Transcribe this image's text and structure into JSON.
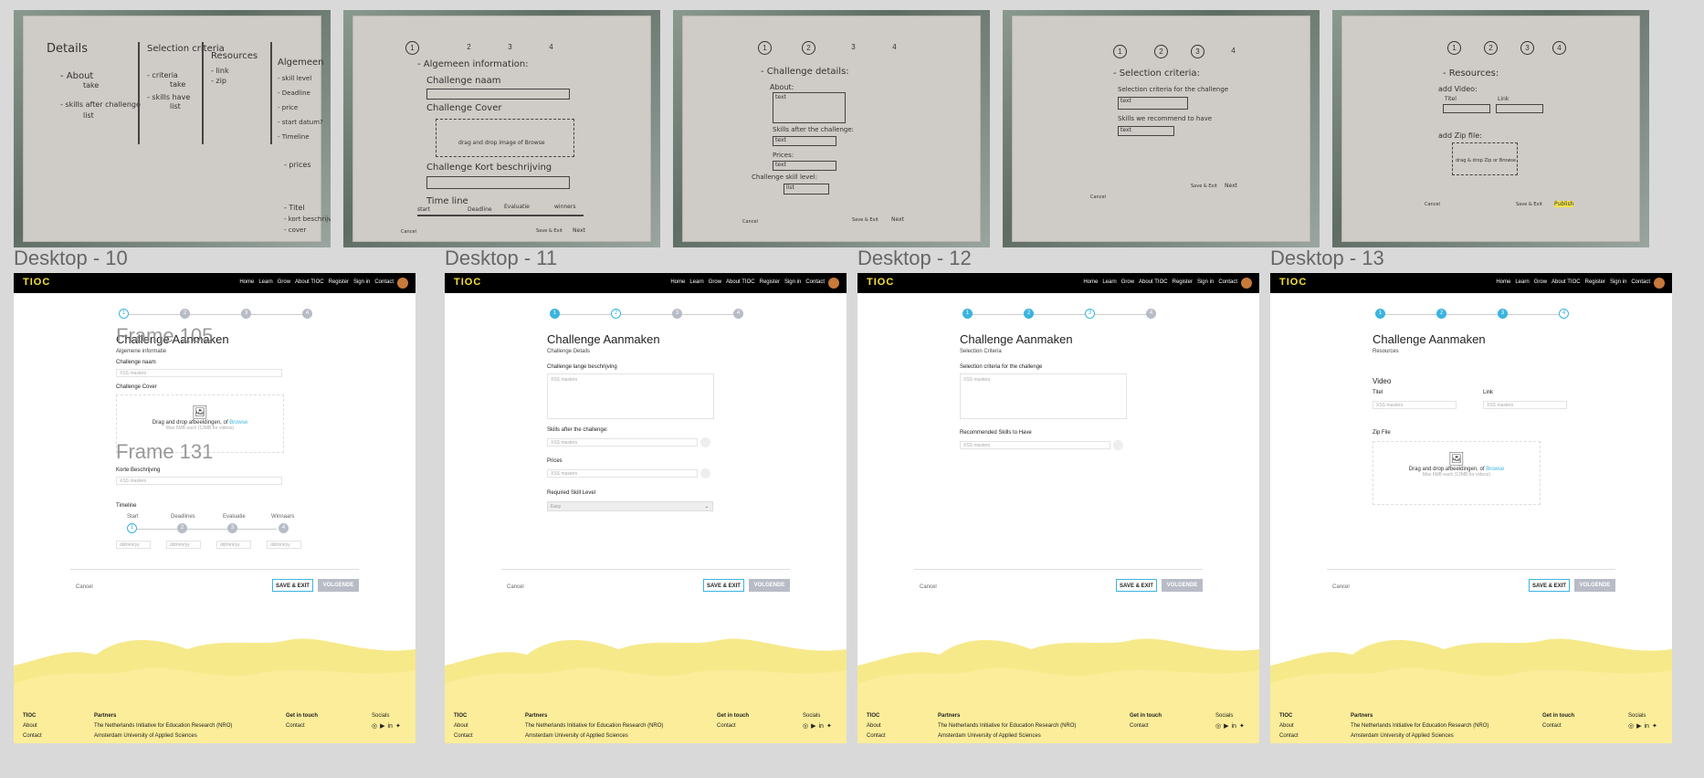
{
  "sketches": {
    "s1": {
      "lines": [
        "Details",
        "- About",
        "take",
        "- skills after challenge",
        "list",
        "Selection criteria",
        "- criteria",
        "take",
        "- skills have",
        "list",
        "Resources",
        "- link",
        "- zip",
        "Algemeen",
        "- skill level",
        "- Deadline",
        "- price",
        "- start datum?",
        "- Timeline",
        "- prices",
        "- Titel",
        "- kort beschrijving",
        "- cover"
      ]
    },
    "s2": {
      "lines": [
        "1",
        "2",
        "3",
        "4",
        "- Algemeen information:",
        "Challenge naam",
        "Challenge Cover",
        "drag and drop image of Browse",
        "Challenge Kort beschrijving",
        "Time line",
        "start",
        "Deadline",
        "Evaluatie",
        "winners",
        "Cancel",
        "Save & Exit",
        "Next"
      ]
    },
    "s3": {
      "lines": [
        "1",
        "2",
        "3",
        "4",
        "- Challenge details:",
        "About:",
        "text",
        "Skills after the challenge:",
        "text",
        "Prices:",
        "text",
        "Challenge skill level:",
        "list",
        "Cancel",
        "Save & Exit",
        "Next"
      ]
    },
    "s4": {
      "lines": [
        "1",
        "2",
        "3",
        "4",
        "- Selection criteria:",
        "Selection criteria for the challenge",
        "text",
        "Skills we recommend to have",
        "text",
        "Cancel",
        "Save & Exit",
        "Next"
      ]
    },
    "s5": {
      "lines": [
        "1",
        "2",
        "3",
        "4",
        "- Resources:",
        "add Video:",
        "Titel",
        "Link",
        "add Zip file:",
        "drag & drop Zip or Browse",
        "Cancel",
        "Save & Exit",
        "Publish"
      ]
    }
  },
  "labels": {
    "d10": "Desktop - 10",
    "d11": "Desktop - 11",
    "d12": "Desktop - 12",
    "d13": "Desktop - 13",
    "frame105": "Frame 105",
    "frame131": "Frame 131"
  },
  "nav": {
    "logo": "TIOC",
    "links": [
      "Home",
      "Learn",
      "Grow",
      "About TIOC",
      "Register",
      "Sign in",
      "Contact"
    ]
  },
  "common": {
    "title": "Challenge Aanmaken",
    "placeholder": "XSS masters",
    "cancel": "Cancel",
    "save": "SAVE & EXIT",
    "next": "VOLGENDE",
    "drop_text": "Drag and drop afbeeldingen, of",
    "browse": "Browse"
  },
  "d10": {
    "subtitle": "Algemene informatie",
    "name_label": "Challenge naam",
    "cover_label": "Challenge Cover",
    "cover_hint": "Max 6MB each (12MB for videos)",
    "short_label": "Korte Beschrijving",
    "timeline_label": "Timeline",
    "steps": [
      "Start",
      "Deadlines",
      "Evaluatie",
      "Winnaars"
    ],
    "date": "dd/mm/yy"
  },
  "d11": {
    "subtitle": "Challenge Details",
    "desc_label": "Challenge lange beschrijving",
    "skills_label": "Skills after the challenge:",
    "prices_label": "Prices",
    "level_label": "Required Skill Level",
    "level_value": "Easy"
  },
  "d12": {
    "subtitle": "Selection Criteria",
    "criteria_label": "Selection criteria for the challenge",
    "rec_label": "Recommended Skills to Have"
  },
  "d13": {
    "subtitle": "Resources",
    "video_label": "Video",
    "titel_label": "Titel",
    "link_label": "Link",
    "zip_label": "Zip File",
    "zip_hint": "Max 6MB each (12MB for videos)"
  },
  "footer": {
    "col1": {
      "head": "TIOC",
      "items": [
        "About",
        "Contact"
      ]
    },
    "col2": {
      "head": "Partners",
      "items": [
        "The Netherlands Initiative for Education Research (NRO)",
        "Amsterdam University of Applied Sciences"
      ]
    },
    "col3": {
      "head": "Get in touch",
      "items": [
        "Contact"
      ]
    },
    "col4": {
      "head": "Socials"
    }
  },
  "colors": {
    "accent": "#3ab4e0",
    "brand_yellow": "#f5e13a",
    "footer_yellow": "#fbe97a"
  }
}
